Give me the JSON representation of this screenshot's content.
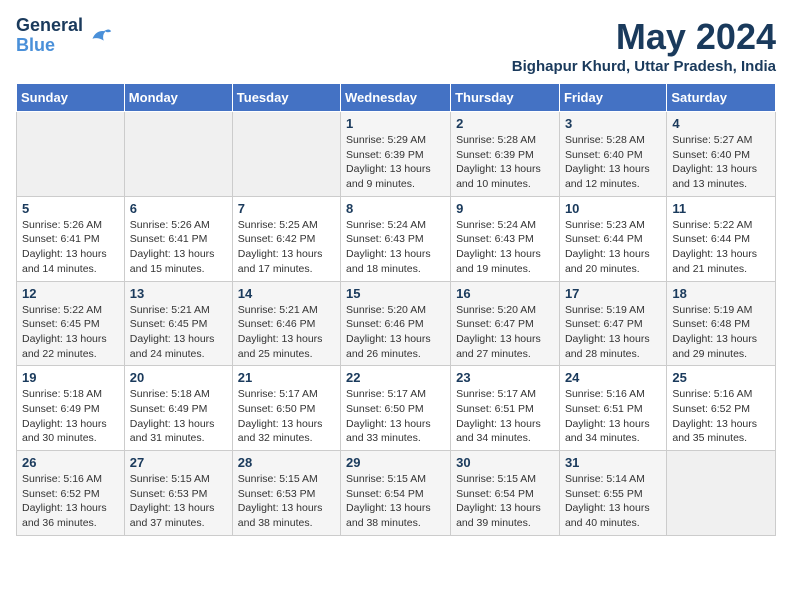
{
  "logo": {
    "general": "General",
    "blue": "Blue"
  },
  "title": {
    "month_year": "May 2024",
    "location": "Bighapur Khurd, Uttar Pradesh, India"
  },
  "days_of_week": [
    "Sunday",
    "Monday",
    "Tuesday",
    "Wednesday",
    "Thursday",
    "Friday",
    "Saturday"
  ],
  "weeks": [
    [
      {
        "day": "",
        "sunrise": "",
        "sunset": "",
        "daylight": ""
      },
      {
        "day": "",
        "sunrise": "",
        "sunset": "",
        "daylight": ""
      },
      {
        "day": "",
        "sunrise": "",
        "sunset": "",
        "daylight": ""
      },
      {
        "day": "1",
        "sunrise": "Sunrise: 5:29 AM",
        "sunset": "Sunset: 6:39 PM",
        "daylight": "Daylight: 13 hours and 9 minutes."
      },
      {
        "day": "2",
        "sunrise": "Sunrise: 5:28 AM",
        "sunset": "Sunset: 6:39 PM",
        "daylight": "Daylight: 13 hours and 10 minutes."
      },
      {
        "day": "3",
        "sunrise": "Sunrise: 5:28 AM",
        "sunset": "Sunset: 6:40 PM",
        "daylight": "Daylight: 13 hours and 12 minutes."
      },
      {
        "day": "4",
        "sunrise": "Sunrise: 5:27 AM",
        "sunset": "Sunset: 6:40 PM",
        "daylight": "Daylight: 13 hours and 13 minutes."
      }
    ],
    [
      {
        "day": "5",
        "sunrise": "Sunrise: 5:26 AM",
        "sunset": "Sunset: 6:41 PM",
        "daylight": "Daylight: 13 hours and 14 minutes."
      },
      {
        "day": "6",
        "sunrise": "Sunrise: 5:26 AM",
        "sunset": "Sunset: 6:41 PM",
        "daylight": "Daylight: 13 hours and 15 minutes."
      },
      {
        "day": "7",
        "sunrise": "Sunrise: 5:25 AM",
        "sunset": "Sunset: 6:42 PM",
        "daylight": "Daylight: 13 hours and 17 minutes."
      },
      {
        "day": "8",
        "sunrise": "Sunrise: 5:24 AM",
        "sunset": "Sunset: 6:43 PM",
        "daylight": "Daylight: 13 hours and 18 minutes."
      },
      {
        "day": "9",
        "sunrise": "Sunrise: 5:24 AM",
        "sunset": "Sunset: 6:43 PM",
        "daylight": "Daylight: 13 hours and 19 minutes."
      },
      {
        "day": "10",
        "sunrise": "Sunrise: 5:23 AM",
        "sunset": "Sunset: 6:44 PM",
        "daylight": "Daylight: 13 hours and 20 minutes."
      },
      {
        "day": "11",
        "sunrise": "Sunrise: 5:22 AM",
        "sunset": "Sunset: 6:44 PM",
        "daylight": "Daylight: 13 hours and 21 minutes."
      }
    ],
    [
      {
        "day": "12",
        "sunrise": "Sunrise: 5:22 AM",
        "sunset": "Sunset: 6:45 PM",
        "daylight": "Daylight: 13 hours and 22 minutes."
      },
      {
        "day": "13",
        "sunrise": "Sunrise: 5:21 AM",
        "sunset": "Sunset: 6:45 PM",
        "daylight": "Daylight: 13 hours and 24 minutes."
      },
      {
        "day": "14",
        "sunrise": "Sunrise: 5:21 AM",
        "sunset": "Sunset: 6:46 PM",
        "daylight": "Daylight: 13 hours and 25 minutes."
      },
      {
        "day": "15",
        "sunrise": "Sunrise: 5:20 AM",
        "sunset": "Sunset: 6:46 PM",
        "daylight": "Daylight: 13 hours and 26 minutes."
      },
      {
        "day": "16",
        "sunrise": "Sunrise: 5:20 AM",
        "sunset": "Sunset: 6:47 PM",
        "daylight": "Daylight: 13 hours and 27 minutes."
      },
      {
        "day": "17",
        "sunrise": "Sunrise: 5:19 AM",
        "sunset": "Sunset: 6:47 PM",
        "daylight": "Daylight: 13 hours and 28 minutes."
      },
      {
        "day": "18",
        "sunrise": "Sunrise: 5:19 AM",
        "sunset": "Sunset: 6:48 PM",
        "daylight": "Daylight: 13 hours and 29 minutes."
      }
    ],
    [
      {
        "day": "19",
        "sunrise": "Sunrise: 5:18 AM",
        "sunset": "Sunset: 6:49 PM",
        "daylight": "Daylight: 13 hours and 30 minutes."
      },
      {
        "day": "20",
        "sunrise": "Sunrise: 5:18 AM",
        "sunset": "Sunset: 6:49 PM",
        "daylight": "Daylight: 13 hours and 31 minutes."
      },
      {
        "day": "21",
        "sunrise": "Sunrise: 5:17 AM",
        "sunset": "Sunset: 6:50 PM",
        "daylight": "Daylight: 13 hours and 32 minutes."
      },
      {
        "day": "22",
        "sunrise": "Sunrise: 5:17 AM",
        "sunset": "Sunset: 6:50 PM",
        "daylight": "Daylight: 13 hours and 33 minutes."
      },
      {
        "day": "23",
        "sunrise": "Sunrise: 5:17 AM",
        "sunset": "Sunset: 6:51 PM",
        "daylight": "Daylight: 13 hours and 34 minutes."
      },
      {
        "day": "24",
        "sunrise": "Sunrise: 5:16 AM",
        "sunset": "Sunset: 6:51 PM",
        "daylight": "Daylight: 13 hours and 34 minutes."
      },
      {
        "day": "25",
        "sunrise": "Sunrise: 5:16 AM",
        "sunset": "Sunset: 6:52 PM",
        "daylight": "Daylight: 13 hours and 35 minutes."
      }
    ],
    [
      {
        "day": "26",
        "sunrise": "Sunrise: 5:16 AM",
        "sunset": "Sunset: 6:52 PM",
        "daylight": "Daylight: 13 hours and 36 minutes."
      },
      {
        "day": "27",
        "sunrise": "Sunrise: 5:15 AM",
        "sunset": "Sunset: 6:53 PM",
        "daylight": "Daylight: 13 hours and 37 minutes."
      },
      {
        "day": "28",
        "sunrise": "Sunrise: 5:15 AM",
        "sunset": "Sunset: 6:53 PM",
        "daylight": "Daylight: 13 hours and 38 minutes."
      },
      {
        "day": "29",
        "sunrise": "Sunrise: 5:15 AM",
        "sunset": "Sunset: 6:54 PM",
        "daylight": "Daylight: 13 hours and 38 minutes."
      },
      {
        "day": "30",
        "sunrise": "Sunrise: 5:15 AM",
        "sunset": "Sunset: 6:54 PM",
        "daylight": "Daylight: 13 hours and 39 minutes."
      },
      {
        "day": "31",
        "sunrise": "Sunrise: 5:14 AM",
        "sunset": "Sunset: 6:55 PM",
        "daylight": "Daylight: 13 hours and 40 minutes."
      },
      {
        "day": "",
        "sunrise": "",
        "sunset": "",
        "daylight": ""
      }
    ]
  ]
}
